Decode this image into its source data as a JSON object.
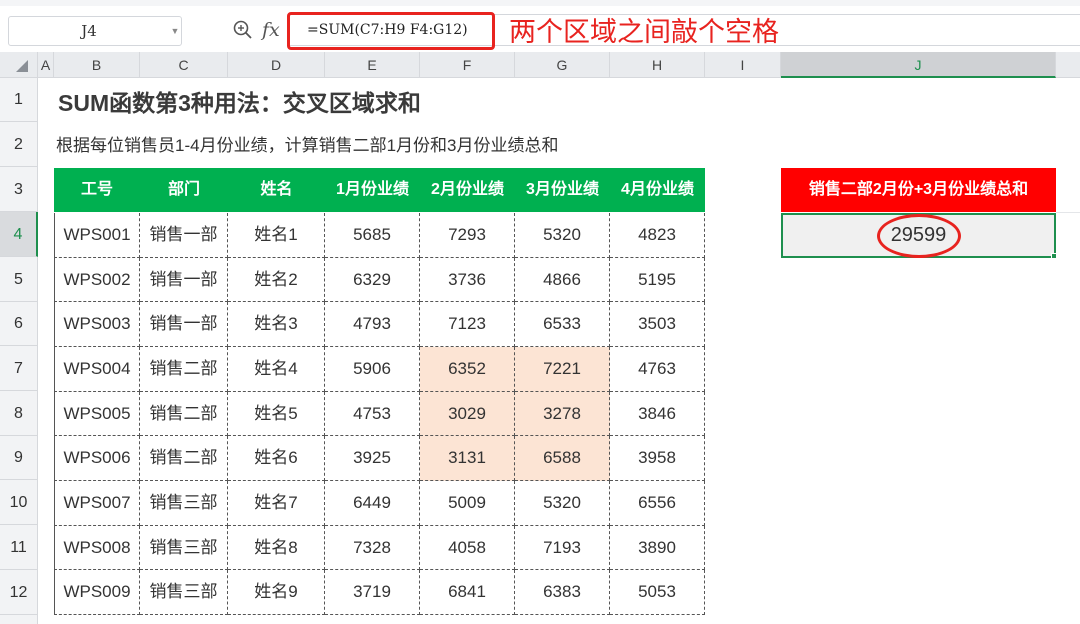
{
  "formula_bar": {
    "name_box": "J4",
    "fx": "fx",
    "formula": "=SUM(C7:H9 F4:G12)",
    "annotation": "两个区域之间敲个空格"
  },
  "columns": [
    "A",
    "B",
    "C",
    "D",
    "E",
    "F",
    "G",
    "H",
    "I",
    "J"
  ],
  "selected_column": "J",
  "rows": [
    "1",
    "2",
    "3",
    "4",
    "5",
    "6",
    "7",
    "8",
    "9",
    "10",
    "11",
    "12"
  ],
  "selected_row": "4",
  "sheet": {
    "title": "SUM函数第3种用法：交叉区域求和",
    "subtitle": "根据每位销售员1-4月份业绩，计算销售二部1月份和3月份业绩总和",
    "table": {
      "headers": [
        "工号",
        "部门",
        "姓名",
        "1月份业绩",
        "2月份业绩",
        "3月份业绩",
        "4月份业绩"
      ],
      "rows": [
        [
          "WPS001",
          "销售一部",
          "姓名1",
          "5685",
          "7293",
          "5320",
          "4823"
        ],
        [
          "WPS002",
          "销售一部",
          "姓名2",
          "6329",
          "3736",
          "4866",
          "5195"
        ],
        [
          "WPS003",
          "销售一部",
          "姓名3",
          "4793",
          "7123",
          "6533",
          "3503"
        ],
        [
          "WPS004",
          "销售二部",
          "姓名4",
          "5906",
          "6352",
          "7221",
          "4763"
        ],
        [
          "WPS005",
          "销售二部",
          "姓名5",
          "4753",
          "3029",
          "3278",
          "3846"
        ],
        [
          "WPS006",
          "销售二部",
          "姓名6",
          "3925",
          "3131",
          "6588",
          "3958"
        ],
        [
          "WPS007",
          "销售三部",
          "姓名7",
          "6449",
          "5009",
          "5320",
          "6556"
        ],
        [
          "WPS008",
          "销售三部",
          "姓名8",
          "7328",
          "4058",
          "7193",
          "3890"
        ],
        [
          "WPS009",
          "销售三部",
          "姓名9",
          "3719",
          "6841",
          "6383",
          "5053"
        ]
      ],
      "highlight": {
        "rows": [
          3,
          4,
          5
        ],
        "cols": [
          4,
          5
        ],
        "color": "#fce4d4"
      }
    },
    "result": {
      "header": "销售二部2月份+3月份业绩总和",
      "value": "29599"
    }
  },
  "colors": {
    "table_header": "#00b050",
    "result_header": "#ff0000",
    "annotation": "#e8231f",
    "selection": "#1e8f4e"
  }
}
